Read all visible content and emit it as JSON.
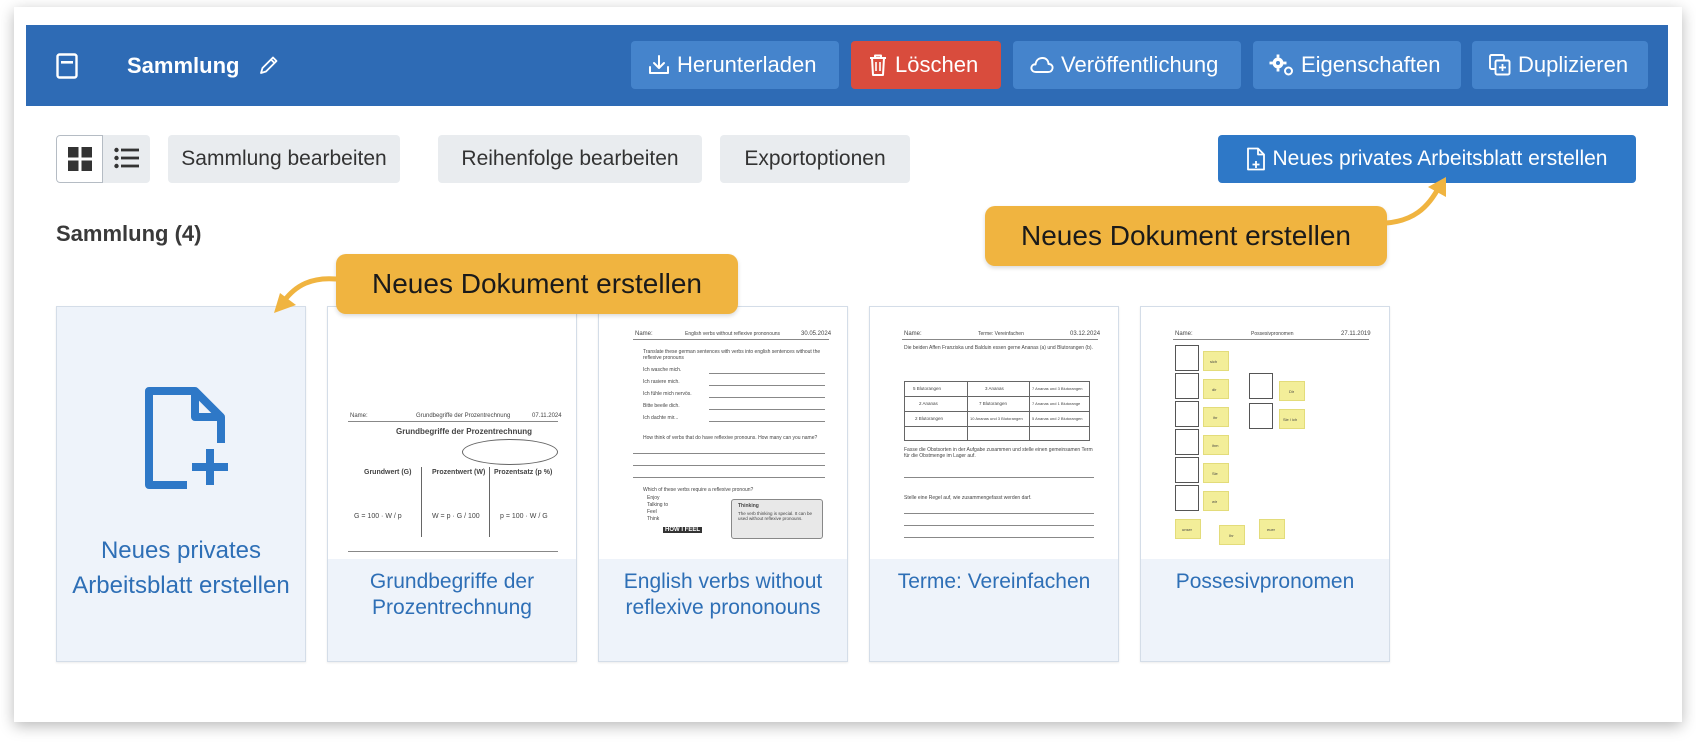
{
  "header": {
    "title": "Sammlung",
    "buttons": {
      "download": "Herunterladen",
      "delete": "Löschen",
      "publish": "Veröffentlichung",
      "properties": "Eigenschaften",
      "duplicate": "Duplizieren"
    }
  },
  "toolbar": {
    "edit_collection": "Sammlung bearbeiten",
    "edit_order": "Reihenfolge bearbeiten",
    "export_options": "Exportoptionen",
    "new_private": "Neues privates Arbeitsblatt erstellen"
  },
  "section": {
    "title": "Sammlung (4)"
  },
  "callouts": {
    "top_right": "Neues Dokument erstellen",
    "left": "Neues Dokument erstellen"
  },
  "cards": [
    {
      "label": "Neues privates Arbeitsblatt erstellen"
    },
    {
      "label": "Grundbegriffe der Prozentrechnung"
    },
    {
      "label": "English verbs without reflexive prononouns"
    },
    {
      "label": "Terme: Vereinfachen"
    },
    {
      "label": "Possesivpronomen"
    }
  ],
  "thumbnails": {
    "card1": {
      "header_left": "Name:",
      "header_mid": "Grundbegriffe der Prozentrechnung",
      "header_right": "07.11.2024",
      "heading": "Grundbegriffe der Prozentrechnung",
      "col1": "Grundwert (G)",
      "col2": "Prozentwert (W)",
      "col3": "Prozentsatz (p %)",
      "f1": "G = 100 · W / p",
      "f2": "W = p · G / 100",
      "f3": "p = 100 · W / G"
    },
    "card2": {
      "header_left": "Name:",
      "header_mid": "English verbs without reflexive prononouns",
      "header_right": "30.05.2024",
      "q1": "Translate these german sentences with verbs into english sentences without the reflexive pronouns",
      "r1": "Ich wasche mich.",
      "r2": "Ich rasiere mich.",
      "r3": "Ich fühle mich nervös.",
      "r4": "Bitte beeile dich.",
      "r5": "Ich dachte mir...",
      "q2": "How think of verbs that do have reflexive pronouns. How many can you name?",
      "q3": "Which of these verbs require a reflexive pronoun?",
      "o1": "Enjoy",
      "o2": "Talking to",
      "o3": "Feel",
      "o4": "Think",
      "thinking_title": "Thinking",
      "thinking_text": "The verb thinking is special. It can be used without reflexive pronouns.",
      "meme": "HOW I FEEL"
    },
    "card3": {
      "header_left": "Name:",
      "header_mid": "Terme: Vereinfachen",
      "header_right": "03.12.2024",
      "intro": "Die beiden Affen Franziska und Balduin essen gerne Ananas (a) und Blutorangen (b).",
      "c1": "5 Blutorangen",
      "c2": "3 Ananas",
      "c3": "7 Ananas und 3 Blutorangen",
      "c4": "2 Ananas",
      "c5": "7 Blutorangen",
      "c6": "7 Ananas und 1 Blutorange",
      "c7": "2 Blutorangen",
      "c8": "10 Ananas und 3 Blutorangen",
      "c9": "5 Ananas und 2 Blutorangen",
      "q2": "Fasse die Obstsorten in der Aufgabe zusammen und stelle einen gemeinsamen Term für die Obstmenge im Lager auf.",
      "q3": "Stelle eine Regel auf, wie zusammengefasst werden darf."
    },
    "card4": {
      "header_left": "Name:",
      "header_mid": "Possesivpronomen",
      "header_right": "27.11.2019",
      "s1": "sich",
      "s2": "dir",
      "s3": "ihr",
      "s4": "ihm",
      "s5": "Sie",
      "s6": "wir",
      "s7": "Dir",
      "s8": "Sie / ich",
      "s9": "unser",
      "s10": "Ihr",
      "s11": "euer"
    }
  }
}
